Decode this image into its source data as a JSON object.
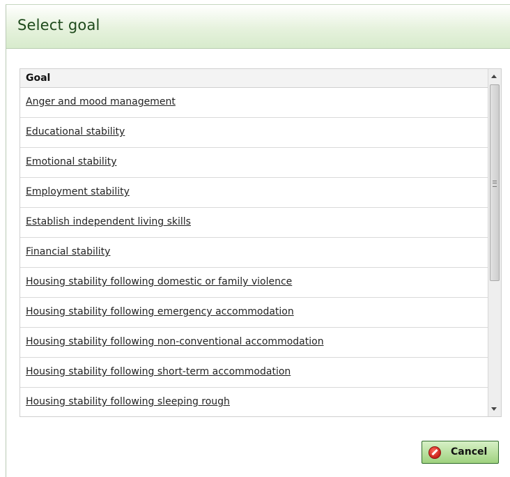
{
  "dialog": {
    "title": "Select goal"
  },
  "grid": {
    "column_header": "Goal",
    "rows": [
      "Anger and mood management",
      "Educational stability",
      "Emotional stability",
      "Employment stability",
      "Establish independent living skills",
      "Financial stability",
      "Housing stability following domestic or family violence",
      "Housing stability following emergency accommodation",
      "Housing stability following non-conventional accommodation",
      "Housing stability following short-term accommodation",
      "Housing stability following sleeping rough"
    ]
  },
  "footer": {
    "cancel_label": "Cancel",
    "cancel_icon": "cancel-icon"
  },
  "colors": {
    "header_gradient_end": "#d7ebcc",
    "button_gradient_end": "#9fd27f",
    "title_text": "#1e4a1c"
  }
}
